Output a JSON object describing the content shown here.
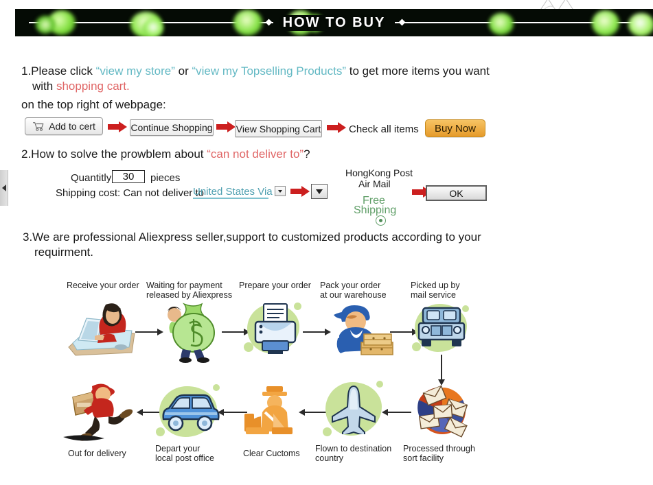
{
  "banner": {
    "title": "HOW TO BUY",
    "left_diamond": "◆",
    "right_diamond": "◆",
    "bg_color": "#050b05",
    "accent_color": "#7ede3b"
  },
  "edge_tab": {
    "icon": "collapse-left-icon"
  },
  "step1": {
    "line1_a": "1.Please click ",
    "link_store": "“view my store”",
    "line1_b": " or ",
    "link_top": "“view my Topselling Products”",
    "line1_c": " to get more items you want",
    "line2_a": "with ",
    "line2_highlight": "shopping cart.",
    "line3": "on the top right of webpage:",
    "link_color": "#64b9c4",
    "highlight_color": "#e06666"
  },
  "cart_flow": {
    "add_to_cart": "Add to cert",
    "cart_icon": "shopping-cart-icon",
    "continue_shopping": "Continue Shopping",
    "view_cart": "View Shopping Cart",
    "check_all_items": "Check all items",
    "buy_now": "Buy Now",
    "buy_now_color": "#e59a2a",
    "arrow_color": "#cc1f1f"
  },
  "step2": {
    "heading_a": "2.How to solve the prowblem about ",
    "heading_highlight": "“can not deliver to”",
    "heading_b": "?",
    "quantity_label": "Quantitly:",
    "quantity_value": "30",
    "pieces_label": "pieces",
    "shipping_label": "Shipping cost: Can not deliver to",
    "country_value": "United States Via",
    "carrier_line1": "HongKong Post",
    "carrier_line2": "Air Mail",
    "free_line1": "Free",
    "free_line2": "Shipping",
    "ok_button": "OK",
    "radio_icon": "radio-selected-icon",
    "dropdown_icon": "chevron-down-icon"
  },
  "step3": {
    "line1": "3.We are professional Aliexpress seller,support to customized products according to your",
    "line2": "requirment."
  },
  "flow": {
    "top_row": [
      {
        "label_line1": "Receive your order",
        "label_line2": "",
        "icon": "person-at-computer-icon"
      },
      {
        "label_line1": "Waiting for payment",
        "label_line2": "released by Aliexpress",
        "icon": "money-bag-icon"
      },
      {
        "label_line1": "Prepare your order",
        "label_line2": "",
        "icon": "printer-icon"
      },
      {
        "label_line1": "Pack your order",
        "label_line2": "at our warehouse",
        "icon": "worker-packing-boxes-icon"
      },
      {
        "label_line1": "Picked up by",
        "label_line2": "mail service",
        "icon": "delivery-truck-icon"
      }
    ],
    "bottom_row": [
      {
        "label_line1": "Out for delivery",
        "label_line2": "",
        "icon": "running-courier-icon"
      },
      {
        "label_line1": "Depart your",
        "label_line2": "local post office",
        "icon": "post-van-icon"
      },
      {
        "label_line1": "Clear Cuctoms",
        "label_line2": "",
        "icon": "customs-officer-icon"
      },
      {
        "label_line1": "Flown to destination",
        "label_line2": "country",
        "icon": "airplane-icon"
      },
      {
        "label_line1": "Processed through",
        "label_line2": "sort facility",
        "icon": "mail-sorting-icon"
      }
    ],
    "splotch_color": "#c9e29a"
  }
}
